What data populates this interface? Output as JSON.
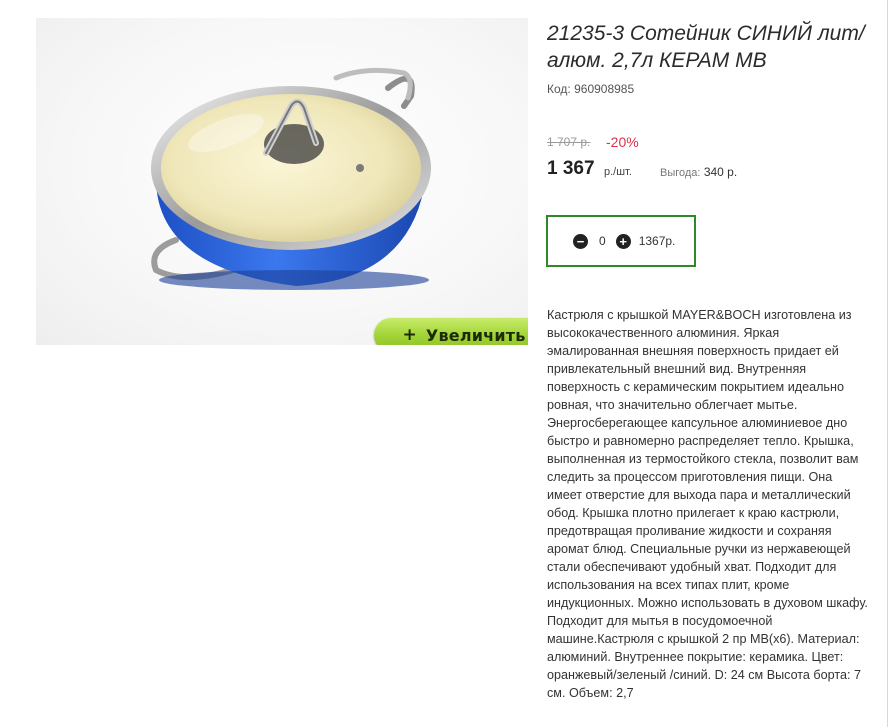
{
  "product": {
    "title": "21235-3 Сотейник СИНИЙ лит/алюм. 2,7л КЕРАМ МВ",
    "code_label": "Код:",
    "code_value": "960908985",
    "image_alt": "Сотейник синий с крышкой",
    "zoom_label": "Увеличить"
  },
  "pricing": {
    "old_price": "1 707 р.",
    "discount": "-20%",
    "price": "1 367",
    "price_unit": "р./шт.",
    "saving_label": "Выгода:",
    "saving_value": "340 р."
  },
  "cart": {
    "minus_icon": "minus-circle-icon",
    "plus_icon": "plus-circle-icon",
    "quantity": "0",
    "sum": "1367р."
  },
  "description": "Кастрюля с крышкой MAYER&BOCH изготовлена из высококачественного алюминия. Яркая эмалированная внешняя поверхность придает ей привлекательный внешний вид. Внутренняя поверхность с керамическим покрытием идеально ровная, что значительно облегчает мытье. Энергосберегающее капсульное алюминиевое дно быстро и равномерно распределяет тепло. Крышка, выполненная из термостойкого стекла, позволит вам следить за процессом приготовления пищи. Она имеет отверстие для выхода пара и металлический обод. Крышка плотно прилегает к краю кастрюли, предотвращая проливание жидкости и сохраняя аромат блюд. Специальные ручки из нержавеющей стали обеспечивают удобный хват. Подходит для использования на всех типах плит, кроме индукционных. Можно использовать в духовом шкафу. Подходит для мытья в посудомоечной машине.Кастрюля с крышкой 2 пр MB(x6). Материал: алюминий. Внутреннее покрытие: керамика. Цвет: оранжевый/зеленый /синий. D: 24 см Высота борта: 7 см. Объем: 2,7",
  "colors": {
    "accent_green": "#2d8a25",
    "discount_red": "#e0304a",
    "button_green": "#9fd233",
    "pan_blue": "#2a63d6"
  }
}
